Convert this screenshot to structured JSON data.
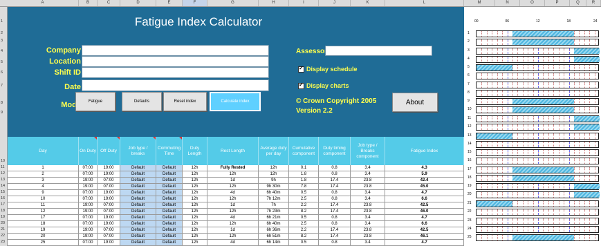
{
  "columns": [
    "A",
    "B",
    "C",
    "D",
    "E",
    "F",
    "G",
    "H",
    "I",
    "J",
    "K",
    "L",
    "M",
    "N",
    "O",
    "P",
    "Q",
    "R"
  ],
  "rows_visible": [
    "1",
    "2",
    "3",
    "4",
    "5",
    "6",
    "7",
    "8",
    "9",
    "10",
    "11",
    "12",
    "13",
    "14",
    "15",
    "16",
    "17",
    "18",
    "19",
    "20",
    "21",
    "22",
    "23",
    "24"
  ],
  "form": {
    "title": "Fatigue Index Calculator",
    "labels": {
      "company": "Company",
      "location": "Location",
      "shift_id": "Shift ID",
      "date": "Date",
      "mode": "Mode",
      "assessor": "Assessor"
    },
    "values": {
      "company": "",
      "location": "",
      "shift_id": "",
      "date": "",
      "assessor": ""
    },
    "buttons": {
      "fatigue": "Fatigue",
      "defaults": "Defaults",
      "reset_index": "Reset index",
      "calculate_index": "Calculate index",
      "about": "About"
    },
    "checkboxes": {
      "display_schedule": "Display schedule",
      "display_charts": "Display charts"
    },
    "checked": {
      "display_schedule": true,
      "display_charts": true
    },
    "copyright": "© Crown Copyright 2005",
    "version": "Version 2.2"
  },
  "table": {
    "headers": [
      "Day",
      "On Duty",
      "Off Duty",
      "Job type / breaks",
      "Commuting Time",
      "Duty Length",
      "Rest Length",
      "Average duty per day",
      "Cumulative component",
      "Duty timing component",
      "Job type / Breaks component",
      "Fatigue Index"
    ],
    "rows": [
      [
        "1",
        "07:00",
        "19:00",
        "Default",
        "Default",
        "12h",
        "Fully Rested",
        "12h",
        "0.1",
        "0.8",
        "3.4",
        "4.3"
      ],
      [
        "2",
        "07:00",
        "19:00",
        "Default",
        "Default",
        "12h",
        "12h",
        "12h",
        "1.8",
        "0.8",
        "3.4",
        "5.9"
      ],
      [
        "3",
        "19:00",
        "07:00",
        "Default",
        "Default",
        "12h",
        "1d",
        "9h",
        "1.8",
        "17.4",
        "23.8",
        "42.4"
      ],
      [
        "4",
        "19:00",
        "07:00",
        "Default",
        "Default",
        "12h",
        "12h",
        "9h 30m",
        "7.8",
        "17.4",
        "23.8",
        "45.0"
      ],
      [
        "9",
        "07:00",
        "19:00",
        "Default",
        "Default",
        "12h",
        "4d",
        "6h 40m",
        "0.5",
        "0.8",
        "3.4",
        "4.7"
      ],
      [
        "10",
        "07:00",
        "19:00",
        "Default",
        "Default",
        "12h",
        "12h",
        "7h 12m",
        "2.5",
        "0.8",
        "3.4",
        "6.6"
      ],
      [
        "11",
        "19:00",
        "07:00",
        "Default",
        "Default",
        "12h",
        "1d",
        "7h",
        "2.2",
        "17.4",
        "23.8",
        "42.5"
      ],
      [
        "12",
        "19:00",
        "07:00",
        "Default",
        "Default",
        "12h",
        "12h",
        "7h 23m",
        "8.2",
        "17.4",
        "23.8",
        "46.0"
      ],
      [
        "17",
        "07:00",
        "19:00",
        "Default",
        "Default",
        "12h",
        "4d",
        "6h 21m",
        "0.5",
        "0.8",
        "3.4",
        "4.7"
      ],
      [
        "18",
        "07:00",
        "19:00",
        "Default",
        "Default",
        "12h",
        "12h",
        "6h 40m",
        "2.5",
        "0.8",
        "3.4",
        "6.6"
      ],
      [
        "19",
        "19:00",
        "07:00",
        "Default",
        "Default",
        "12h",
        "1d",
        "6h 36m",
        "2.2",
        "17.4",
        "23.8",
        "42.5"
      ],
      [
        "20",
        "19:00",
        "07:00",
        "Default",
        "Default",
        "12h",
        "12h",
        "6h 51m",
        "8.2",
        "17.4",
        "23.8",
        "46.1"
      ],
      [
        "25",
        "07:00",
        "19:00",
        "Default",
        "Default",
        "12h",
        "4d",
        "6h 14m",
        "0.5",
        "0.8",
        "3.4",
        "4.7"
      ],
      [
        "26",
        "07:00",
        "19:00",
        "Default",
        "Default",
        "12h",
        "12h",
        "6h 28m",
        "2.5",
        "0.8",
        "3.4",
        "6.6"
      ]
    ]
  },
  "schedule": {
    "hour_labels": [
      "00",
      "06",
      "12",
      "18",
      "24"
    ],
    "row_numbers": [
      "1",
      "2",
      "3",
      "4",
      "5",
      "6",
      "7",
      "8",
      "9",
      "10",
      "11",
      "12",
      "13",
      "14",
      "15",
      "16",
      "17",
      "18",
      "19",
      "20",
      "21",
      "22",
      "23",
      "24",
      "25"
    ],
    "shifts": [
      "day",
      "day",
      "night",
      "night",
      "off",
      "off",
      "off",
      "off",
      "day",
      "day",
      "night",
      "night",
      "off",
      "off",
      "off",
      "off",
      "day",
      "day",
      "night",
      "night",
      "off",
      "off",
      "off",
      "off",
      "day"
    ],
    "block_color": "#4fb6e0"
  }
}
